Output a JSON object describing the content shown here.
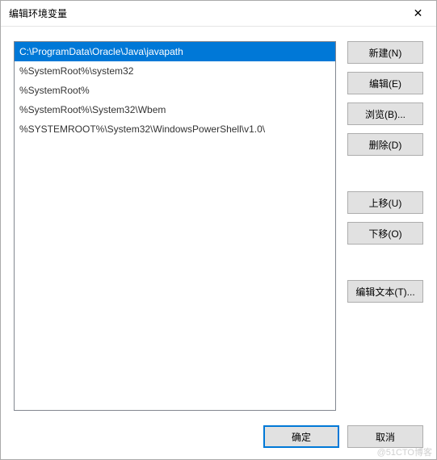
{
  "dialog": {
    "title": "编辑环境变量",
    "close_icon": "✕"
  },
  "list": {
    "items": [
      {
        "text": "C:\\ProgramData\\Oracle\\Java\\javapath",
        "selected": true
      },
      {
        "text": "%SystemRoot%\\system32",
        "selected": false
      },
      {
        "text": "%SystemRoot%",
        "selected": false
      },
      {
        "text": "%SystemRoot%\\System32\\Wbem",
        "selected": false
      },
      {
        "text": "%SYSTEMROOT%\\System32\\WindowsPowerShell\\v1.0\\",
        "selected": false
      }
    ]
  },
  "buttons": {
    "new": "新建(N)",
    "edit": "编辑(E)",
    "browse": "浏览(B)...",
    "delete": "删除(D)",
    "move_up": "上移(U)",
    "move_down": "下移(O)",
    "edit_text": "编辑文本(T)...",
    "ok": "确定",
    "cancel": "取消"
  },
  "watermark": "@51CTO博客"
}
